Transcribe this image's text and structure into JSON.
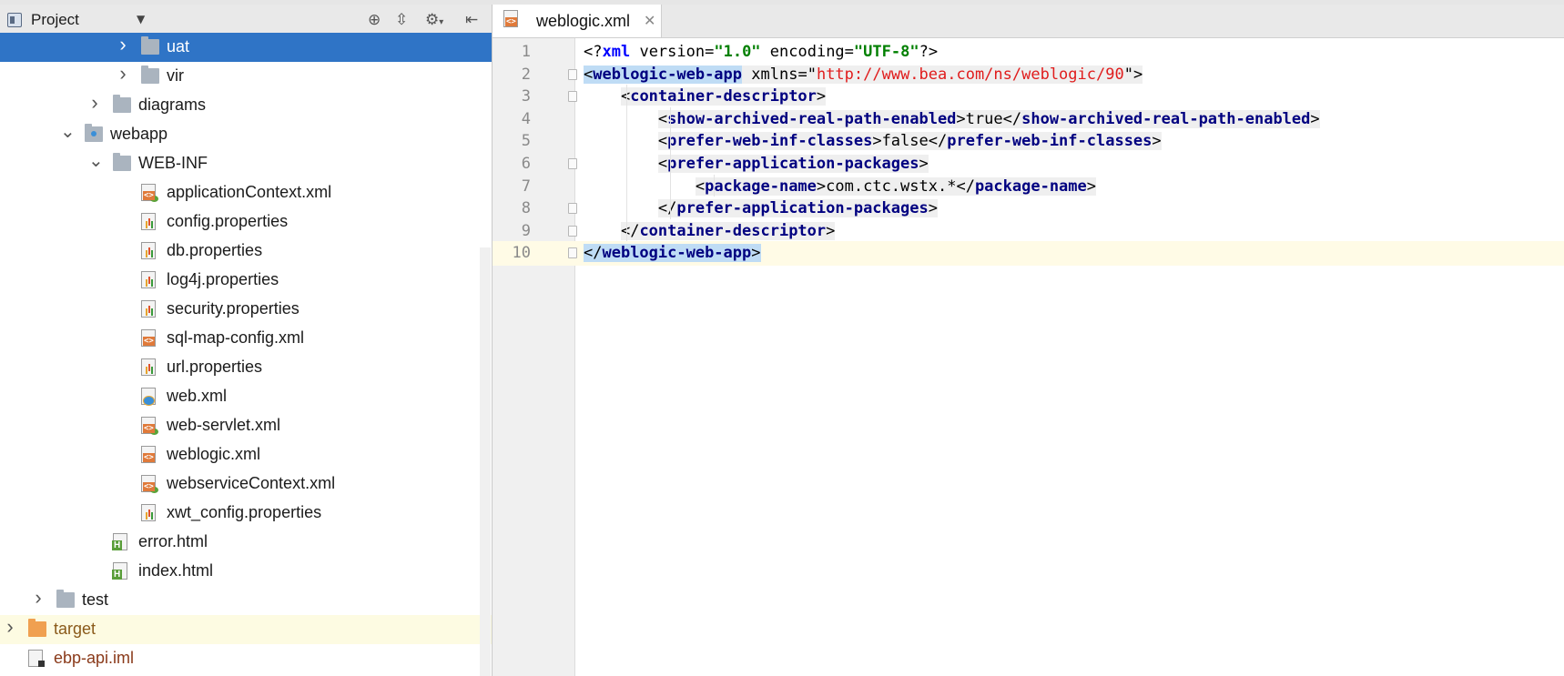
{
  "project_panel": {
    "title": "Project",
    "dropdown_icon": "chevron-down-icon",
    "toolbar_icons": [
      "locate-icon",
      "collapse-all-icon",
      "gear-icon",
      "hide-panel-icon"
    ],
    "tree": [
      {
        "label": "uat",
        "type": "folder",
        "expanded": false,
        "selected": true,
        "depth": 5
      },
      {
        "label": "vir",
        "type": "folder",
        "expanded": false,
        "depth": 5
      },
      {
        "label": "diagrams",
        "type": "folder",
        "expanded": false,
        "depth": 4
      },
      {
        "label": "webapp",
        "type": "web-folder",
        "expanded": true,
        "depth": 3
      },
      {
        "label": "WEB-INF",
        "type": "folder",
        "expanded": true,
        "depth": 4
      },
      {
        "label": "applicationContext.xml",
        "type": "spring-xml",
        "depth": 5
      },
      {
        "label": "config.properties",
        "type": "properties",
        "depth": 5
      },
      {
        "label": "db.properties",
        "type": "properties",
        "depth": 5
      },
      {
        "label": "log4j.properties",
        "type": "properties",
        "depth": 5
      },
      {
        "label": "security.properties",
        "type": "properties",
        "depth": 5
      },
      {
        "label": "sql-map-config.xml",
        "type": "xml",
        "depth": 5
      },
      {
        "label": "url.properties",
        "type": "properties",
        "depth": 5
      },
      {
        "label": "web.xml",
        "type": "web-xml",
        "depth": 5
      },
      {
        "label": "web-servlet.xml",
        "type": "spring-xml",
        "depth": 5
      },
      {
        "label": "weblogic.xml",
        "type": "xml",
        "depth": 5
      },
      {
        "label": "webserviceContext.xml",
        "type": "spring-xml",
        "depth": 5
      },
      {
        "label": "xwt_config.properties",
        "type": "properties",
        "depth": 5
      },
      {
        "label": "error.html",
        "type": "html",
        "depth": 4
      },
      {
        "label": "index.html",
        "type": "html",
        "depth": 4
      },
      {
        "label": "test",
        "type": "folder",
        "expanded": false,
        "depth": 2
      },
      {
        "label": "target",
        "type": "orange-folder",
        "expanded": false,
        "depth": 1,
        "highlight": true
      },
      {
        "label": "ebp-api.iml",
        "type": "iml",
        "depth": 1,
        "highlight_text": true
      }
    ]
  },
  "editor": {
    "tab": {
      "label": "weblogic.xml",
      "close_icon": "close-icon",
      "file_icon": "xml-file-icon"
    },
    "current_line": 10,
    "lines": [
      {
        "n": "1",
        "code": "<?xml version=\"1.0\" encoding=\"UTF-8\"?>"
      },
      {
        "n": "2",
        "code": "<weblogic-web-app xmlns=\"http://www.bea.com/ns/weblogic/90\">"
      },
      {
        "n": "3",
        "code": "    <container-descriptor>"
      },
      {
        "n": "4",
        "code": "        <show-archived-real-path-enabled>true</show-archived-real-path-enabled>"
      },
      {
        "n": "5",
        "code": "        <prefer-web-inf-classes>false</prefer-web-inf-classes>"
      },
      {
        "n": "6",
        "code": "        <prefer-application-packages>"
      },
      {
        "n": "7",
        "code": "            <package-name>com.ctc.wstx.*</package-name>"
      },
      {
        "n": "8",
        "code": "        </prefer-application-packages>"
      },
      {
        "n": "9",
        "code": "    </container-descriptor>"
      },
      {
        "n": "10",
        "code": "</weblogic-web-app>"
      }
    ]
  }
}
